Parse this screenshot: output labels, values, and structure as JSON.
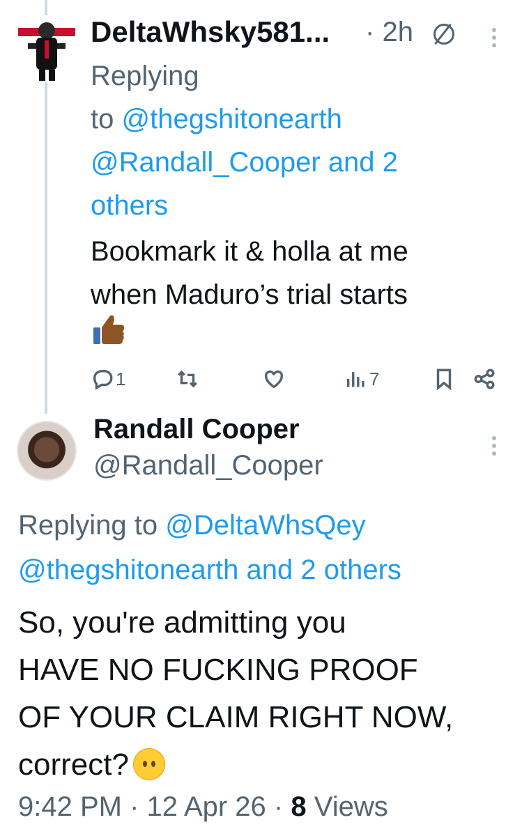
{
  "tweet1": {
    "display_name": "DeltaWhsky581...",
    "separator": "·",
    "time": "2h",
    "reply_prefix": "Replying",
    "reply_to_word": "to",
    "reply_handle_1": "@thegshitonearth",
    "reply_handle_2": "@Randall_Cooper",
    "reply_and_others": "and 2",
    "reply_others_word": "others",
    "text_line1": "Bookmark it & holla at me",
    "text_line2": "when Maduro’s trial starts",
    "reply_count": "1",
    "views_count": "7",
    "icons": [
      "circle-slash-icon",
      "more-icon",
      "reply-icon",
      "retweet-icon",
      "like-icon",
      "views-icon",
      "bookmark-icon",
      "share-icon",
      "thumbs-up-emoji"
    ]
  },
  "tweet2": {
    "display_name": "Randall Cooper",
    "handle": "@Randall_Cooper",
    "replying_to": "Replying to",
    "reply_handle_1": "@DeltaWhsQey",
    "reply_handle_2": "@thegshitonearth",
    "reply_and_others": "and 2 others",
    "text_line1": "So, you're admitting you",
    "text_line2": "HAVE NO FUCKING PROOF",
    "text_line3": "OF YOUR CLAIM RIGHT NOW,",
    "text_line4": "correct?",
    "footer_time": "9:42 PM",
    "footer_sep": "·",
    "footer_date": "12 Apr 26",
    "footer_views_count": "8",
    "footer_views_label": "Views"
  },
  "colors": {
    "link": "#1d9bf0",
    "secondary_text": "#536471",
    "primary_text": "#0f1419",
    "thread_line": "#cfd9de"
  }
}
